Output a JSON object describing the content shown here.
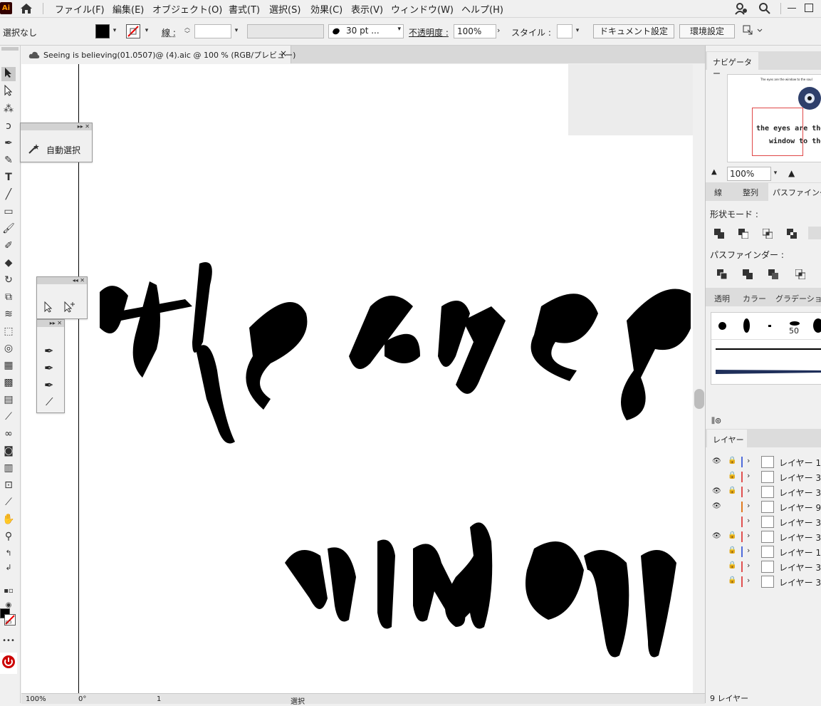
{
  "menubar": {
    "app_logo": "Ai",
    "items": [
      "ファイル(F)",
      "編集(E)",
      "オブジェクト(O)",
      "書式(T)",
      "選択(S)",
      "効果(C)",
      "表示(V)",
      "ウィンドウ(W)",
      "ヘルプ(H)"
    ]
  },
  "control_bar": {
    "selection_label": "選択なし",
    "stroke_label": "線 :",
    "brush_size": "30 pt ...",
    "opacity_label": "不透明度 :",
    "opacity_value": "100%",
    "style_label": "スタイル :",
    "doc_settings_button": "ドキュメント設定",
    "prefs_button": "環境設定",
    "fill_color": "#000000",
    "stroke_color": "none"
  },
  "document": {
    "tab_title": "Seeing is believing(01.0507)@ (4).aic @ 100 % (RGB/プレビュー)",
    "close_symbol": "×"
  },
  "floating_panels": {
    "magic_wand_label": "自動選択"
  },
  "artwork": {
    "line1": "the eyes",
    "line2": "window"
  },
  "navigator": {
    "tab": "ナビゲーター",
    "zoom": "100%",
    "thumb_text_top": "The eyes are the window to the soul",
    "thumb_line1": "the eyes are the",
    "thumb_line2": "window to the"
  },
  "pathfinder_group": {
    "tabs": [
      "線",
      "整列",
      "パスファインダー"
    ],
    "shape_mode_label": "形状モード :",
    "pathfinder_label": "パスファインダー :"
  },
  "brush_group": {
    "tabs": [
      "透明",
      "カラー",
      "グラデーション"
    ],
    "brush_size_number": "50"
  },
  "layers": {
    "tab": "レイヤー",
    "rows": [
      {
        "name": "レイヤー 1",
        "visible": true,
        "locked": true,
        "color": "#4f6bdb"
      },
      {
        "name": "レイヤー 3",
        "visible": false,
        "locked": true,
        "color": "#e05050"
      },
      {
        "name": "レイヤー 3",
        "visible": true,
        "locked": true,
        "color": "#e05050"
      },
      {
        "name": "レイヤー 9",
        "visible": true,
        "locked": false,
        "color": "#e07a20"
      },
      {
        "name": "レイヤー 3",
        "visible": false,
        "locked": false,
        "color": "#e05050"
      },
      {
        "name": "レイヤー 3",
        "visible": true,
        "locked": true,
        "color": "#e05050"
      },
      {
        "name": "レイヤー 1",
        "visible": false,
        "locked": true,
        "color": "#4f6bdb"
      },
      {
        "name": "レイヤー 3",
        "visible": false,
        "locked": true,
        "color": "#e05050"
      },
      {
        "name": "レイヤー 3",
        "visible": false,
        "locked": true,
        "color": "#e05050"
      }
    ],
    "count_label": "9 レイヤー"
  },
  "statusbar": {
    "zoom": "100%",
    "rotation": "0°",
    "artboard": "1",
    "mode": "選択"
  }
}
